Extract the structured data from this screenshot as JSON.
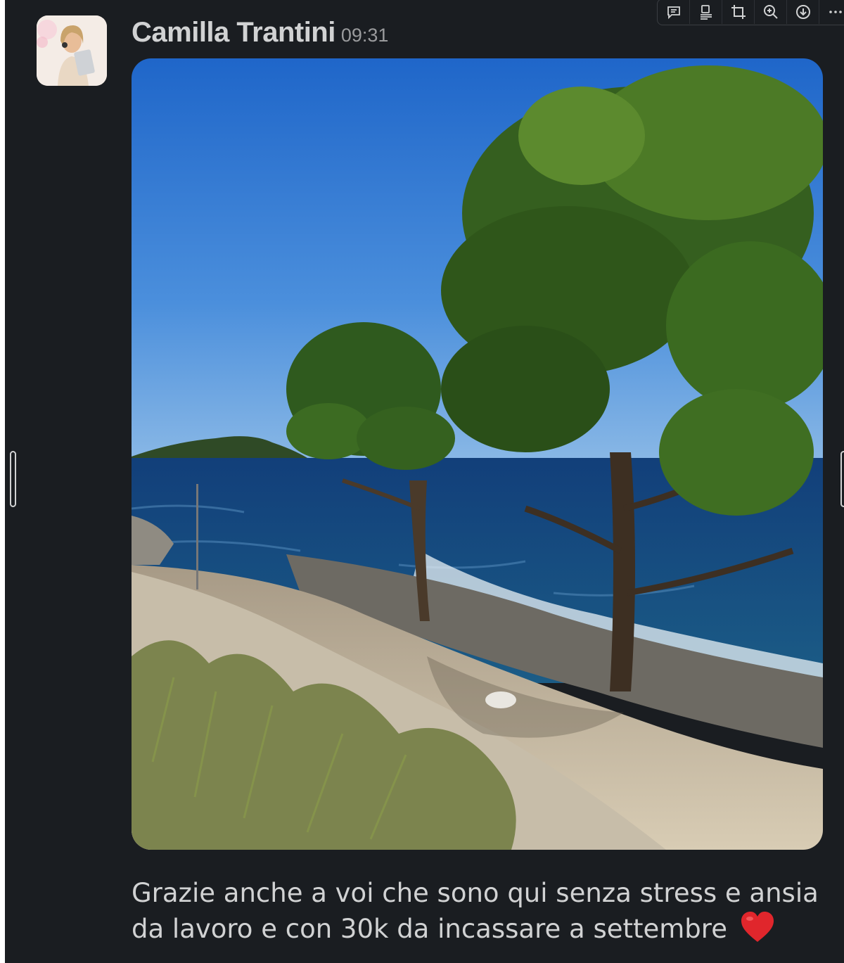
{
  "message": {
    "sender_name": "Camilla Trantini",
    "timestamp": "09:31",
    "text": "Grazie anche a voi che sono qui senza stress e ansia da lavoro e con 30k da incassare a settembre",
    "emoji": "red-heart-icon"
  },
  "toolbar": {
    "icons": [
      "comment-icon",
      "save-icon",
      "crop-icon",
      "zoom-in-icon",
      "download-icon",
      "more-icon"
    ]
  },
  "colors": {
    "background": "#1a1d21",
    "text": "#d1d2d3",
    "muted": "#9a9b9d",
    "heart": "#e0262c"
  }
}
